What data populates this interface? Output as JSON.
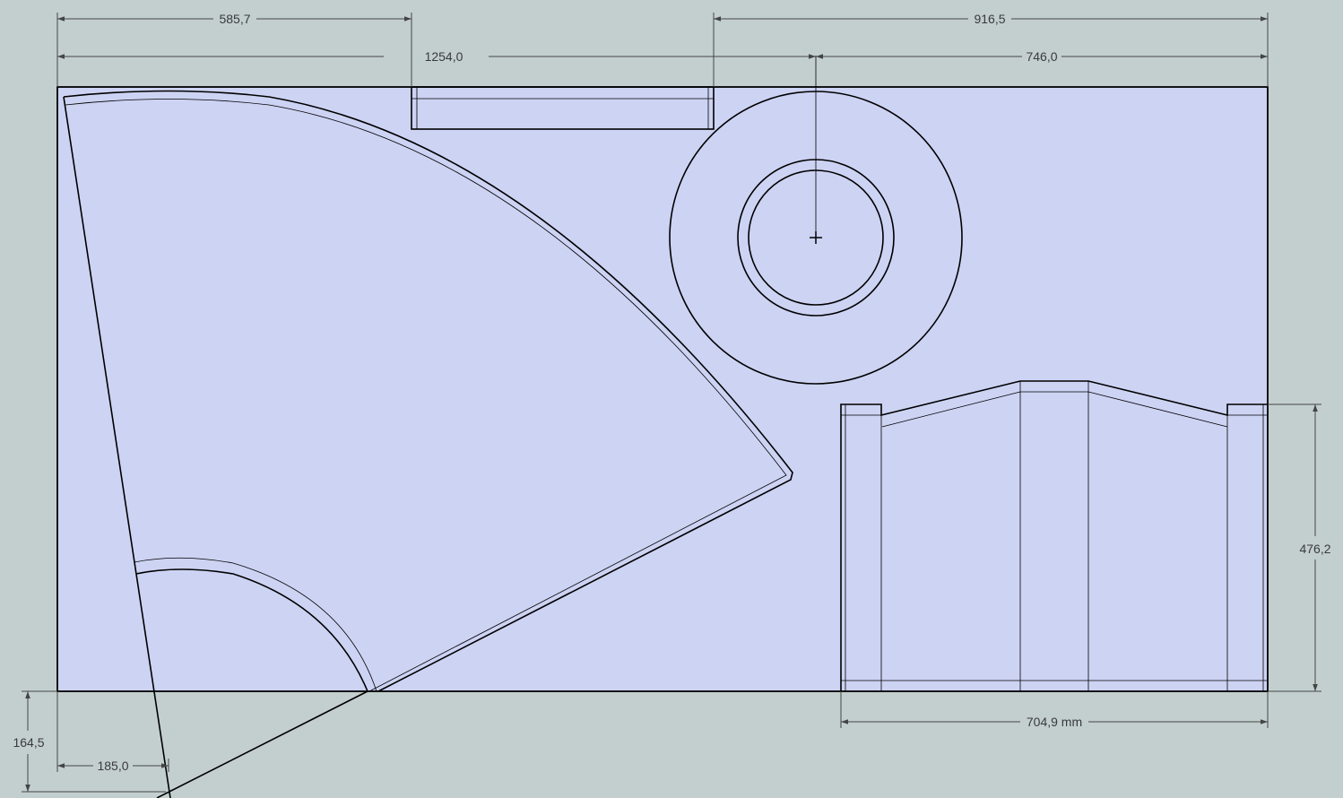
{
  "colors": {
    "background": "#c3cfcf",
    "face": "#cdd3f3",
    "edge": "#000000",
    "dimension": "#444444"
  },
  "dimensions": {
    "d1": "585,7",
    "d2": "916,5",
    "d3": "1254,0",
    "d4": "746,0",
    "d5": "476,2",
    "d6": "704,9 mm",
    "d7": "164,5",
    "d8": "185,0"
  },
  "icons": {
    "center_mark": "crosshair-icon",
    "arrow": "arrowhead-icon"
  }
}
